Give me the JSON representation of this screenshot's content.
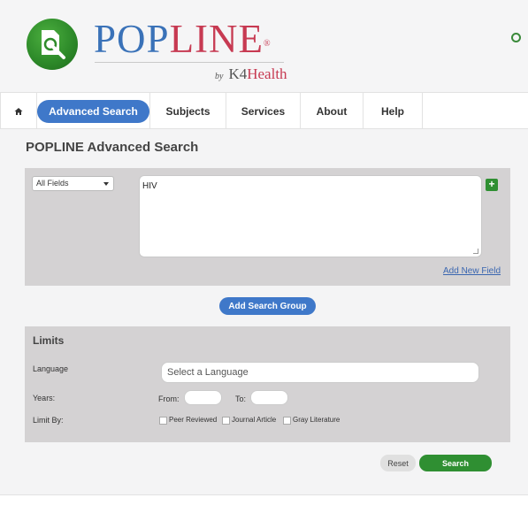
{
  "header": {
    "brand_pop": "POP",
    "brand_line": "LINE",
    "brand_reg": "®",
    "by": "by",
    "k4": "K4",
    "health": "Health"
  },
  "nav": {
    "home_icon": "home-icon",
    "items": [
      {
        "label": "Advanced Search",
        "active": true
      },
      {
        "label": "Subjects"
      },
      {
        "label": "Services"
      },
      {
        "label": "About"
      },
      {
        "label": "Help"
      }
    ]
  },
  "main": {
    "title": "POPLINE Advanced Search",
    "search_group": {
      "field_select": "All Fields",
      "query": "HIV",
      "add_field_link": "Add New Field",
      "add_icon": "plus-icon"
    },
    "add_group_label": "Add Search Group",
    "limits": {
      "title": "Limits",
      "language_label": "Language",
      "language_placeholder": "Select a Language",
      "years_label": "Years:",
      "from_label": "From:",
      "to_label": "To:",
      "limit_by_label": "Limit By:",
      "options": [
        "Peer Reviewed",
        "Journal Article",
        "Gray Literature"
      ]
    },
    "reset_label": "Reset",
    "search_label": "Search"
  },
  "colors": {
    "accent_blue": "#3f78c9",
    "brand_red": "#c73a52",
    "search_green": "#2f8f32",
    "panel_gray": "#d4d2d3"
  }
}
